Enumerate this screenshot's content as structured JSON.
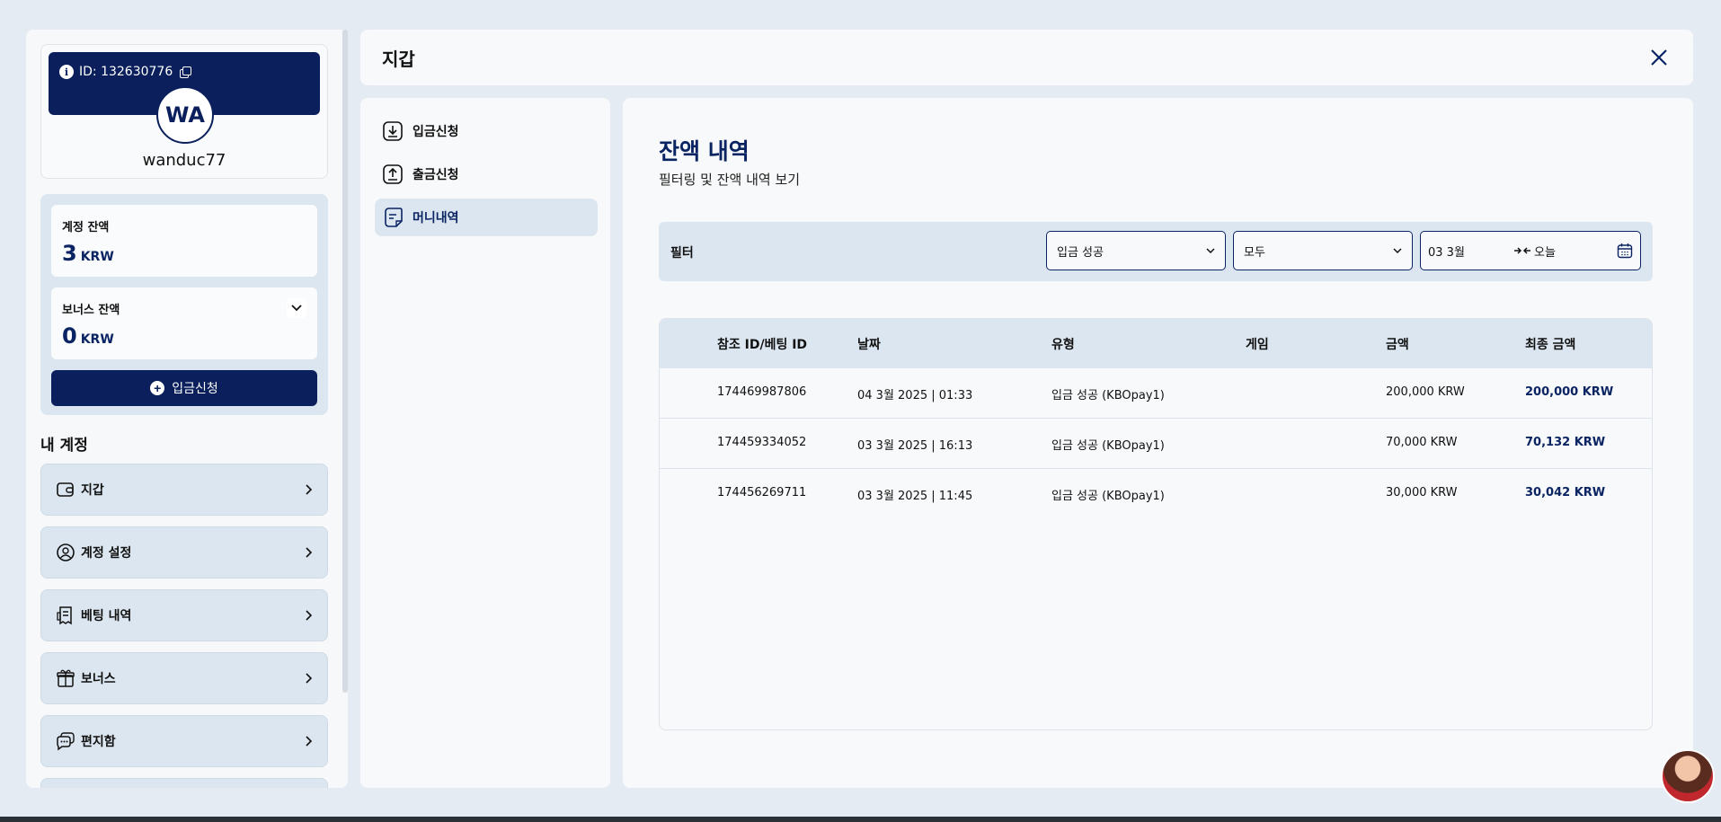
{
  "profile": {
    "id_label": "ID: 132630776",
    "initials": "WA",
    "username": "wanduc77"
  },
  "balances": {
    "account_label": "계정 잔액",
    "account_value": "3",
    "account_unit": "KRW",
    "bonus_label": "보너스 잔액",
    "bonus_value": "0",
    "bonus_unit": "KRW",
    "deposit_button": "입금신청"
  },
  "my_account": {
    "title": "내 계정",
    "items": [
      {
        "label": "지갑",
        "icon": "wallet-icon"
      },
      {
        "label": "계정 설정",
        "icon": "user-settings-icon"
      },
      {
        "label": "베팅 내역",
        "icon": "receipt-icon"
      },
      {
        "label": "보너스",
        "icon": "gift-icon"
      },
      {
        "label": "편지함",
        "icon": "chat-icon"
      }
    ]
  },
  "header": {
    "title": "지갑"
  },
  "submenu": {
    "items": [
      {
        "label": "입금신청",
        "icon": "download-icon"
      },
      {
        "label": "출금신청",
        "icon": "upload-icon"
      },
      {
        "label": "머니내역",
        "icon": "document-icon"
      }
    ]
  },
  "content": {
    "title": "잔액 내역",
    "subtitle": "필터링 및 잔액 내역 보기"
  },
  "filter": {
    "label": "필터",
    "status_value": "입금 성공",
    "type_value": "모두",
    "date_from": "03 3월",
    "date_to": "오늘"
  },
  "table": {
    "headers": [
      "참조 ID/베팅 ID",
      "날짜",
      "유형",
      "게임",
      "금액",
      "최종 금액"
    ],
    "rows": [
      {
        "ref": "174469987806",
        "date": "04 3월 2025 | 01:33",
        "type": "입금 성공 (KBOpay1)",
        "game": "",
        "amount": "200,000 KRW",
        "final": "200,000 KRW"
      },
      {
        "ref": "174459334052",
        "date": "03 3월 2025 | 16:13",
        "type": "입금 성공 (KBOpay1)",
        "game": "",
        "amount": "70,000 KRW",
        "final": "70,132 KRW"
      },
      {
        "ref": "174456269711",
        "date": "03 3월 2025 | 11:45",
        "type": "입금 성공 (KBOpay1)",
        "game": "",
        "amount": "30,000 KRW",
        "final": "30,042 KRW"
      }
    ]
  },
  "colors": {
    "navy": "#0a1f5c",
    "light_blue": "#dce6f0"
  }
}
